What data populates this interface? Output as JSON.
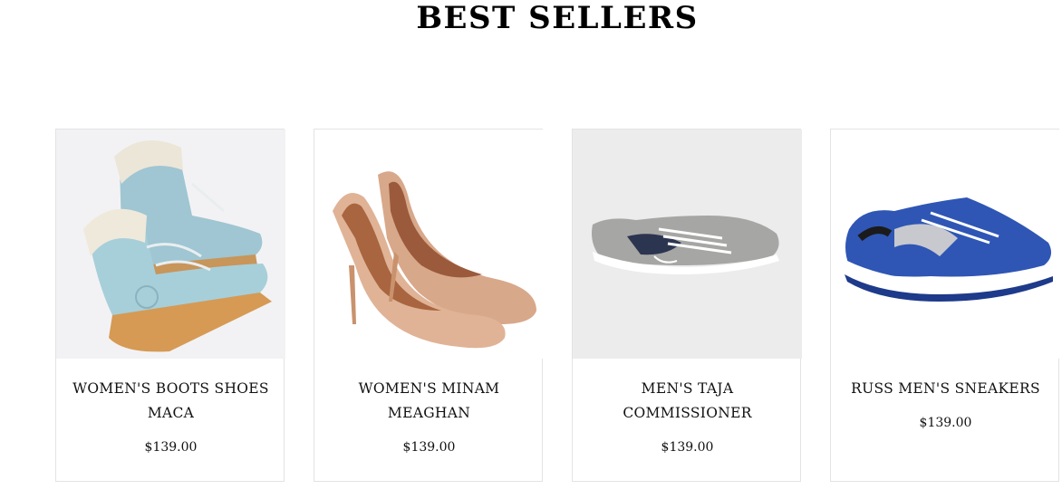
{
  "section": {
    "title": "BEST SELLERS"
  },
  "products": [
    {
      "name": "WOMEN'S BOOTS SHOES MACA",
      "price": "$139.00",
      "image": "light-blue-boots-image"
    },
    {
      "name": "WOMEN'S MINAM MEAGHAN",
      "price": "$139.00",
      "image": "tan-high-heels-image"
    },
    {
      "name": "MEN'S TAJA COMMISSIONER",
      "price": "$139.00",
      "image": "grey-sneaker-image"
    },
    {
      "name": "RUSS MEN'S SNEAKERS",
      "price": "$139.00",
      "image": "blue-running-shoe-image"
    }
  ],
  "colors": {
    "card_border": "#e3e3e3",
    "text": "#111111"
  }
}
